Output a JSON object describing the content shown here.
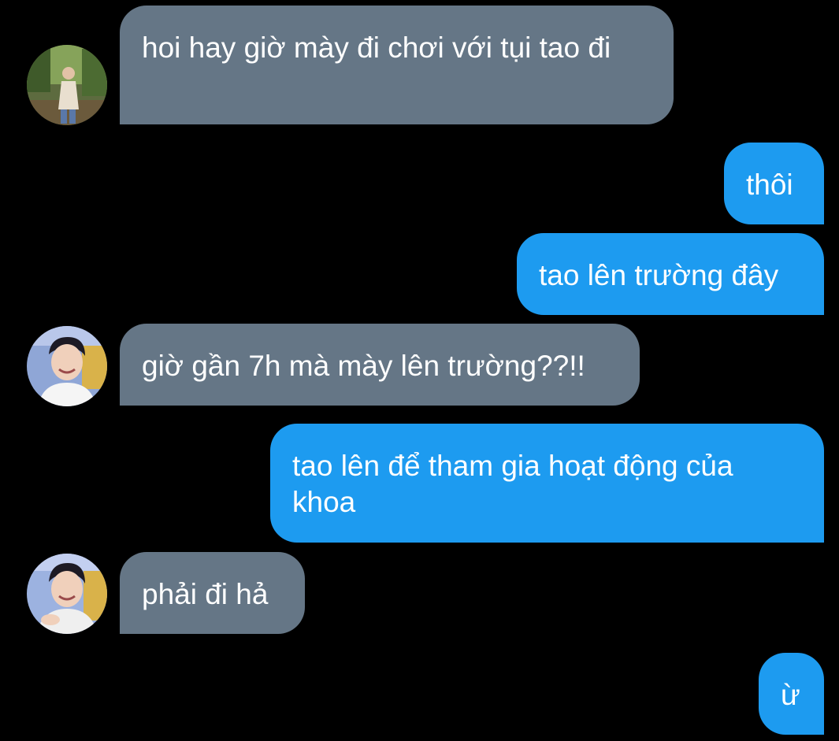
{
  "conversation": {
    "messages": [
      {
        "direction": "incoming",
        "avatar": "friend-a-avatar",
        "text": "hoi hay giờ mày đi chơi với tụi tao đi"
      },
      {
        "direction": "outgoing",
        "text": "thôi"
      },
      {
        "direction": "outgoing",
        "text": "tao lên trường đây"
      },
      {
        "direction": "incoming",
        "avatar": "friend-b-avatar",
        "text": "giờ gần 7h mà mày lên trường??!!"
      },
      {
        "direction": "outgoing",
        "text": "tao lên để tham gia hoạt động của khoa"
      },
      {
        "direction": "incoming",
        "avatar": "friend-b-avatar",
        "text": "phải đi hả"
      },
      {
        "direction": "outgoing",
        "text": "ừ"
      }
    ]
  },
  "colors": {
    "background": "#000000",
    "incoming_bubble": "#657686",
    "outgoing_bubble": "#1d9bf0",
    "text": "#ffffff"
  }
}
